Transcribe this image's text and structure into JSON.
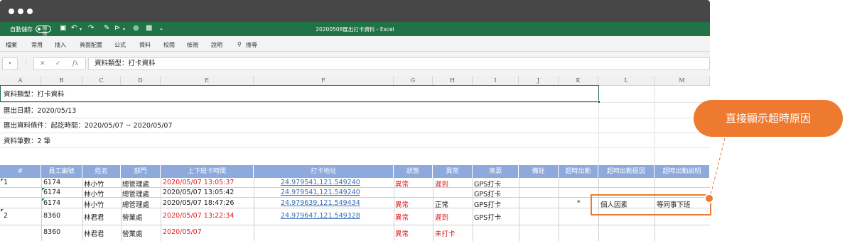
{
  "titlebar": {
    "autosave_label": "自動儲存",
    "autosave_state": "關閉",
    "title": "20200508匯出打卡資料 - Excel"
  },
  "menu": [
    "檔案",
    "常用",
    "插入",
    "頁面配置",
    "公式",
    "資料",
    "校閱",
    "檢視",
    "說明",
    "搜尋"
  ],
  "formula_bar": {
    "value": "資料類型：打卡資料"
  },
  "columns": [
    "A",
    "B",
    "C",
    "D",
    "E",
    "F",
    "G",
    "H",
    "I",
    "J",
    "K",
    "L",
    "M"
  ],
  "info_lines": [
    "資料類型：打卡資料",
    "匯出日期：2020/05/13",
    "匯出資料條件：起訖時間：2020/05/07 ~ 2020/05/07",
    "資料筆數：2 筆"
  ],
  "table": {
    "headers": [
      "#",
      "員工編號",
      "姓名",
      "部門",
      "上下班卡時間",
      "打卡地址",
      "狀態",
      "異常",
      "來源",
      "備註",
      "超時出勤",
      "超時出勤原因",
      "超時出勤說明"
    ],
    "rows": [
      [
        "1",
        "6174",
        "林小竹",
        "總管理處",
        "2020/05/07 13:05:37",
        "24.979541,121.549240",
        "異常",
        "遲到",
        "GPS打卡",
        "",
        "",
        "",
        ""
      ],
      [
        "",
        "6174",
        "林小竹",
        "總管理處",
        "2020/05/07 13:05:42",
        "24.979541,121.549240",
        "",
        "",
        "GPS打卡",
        "",
        "",
        "",
        ""
      ],
      [
        "",
        "6174",
        "林小竹",
        "總管理處",
        "2020/05/07 18:47:26",
        "24.979639,121.549434",
        "異常",
        "正常",
        "GPS打卡",
        "",
        "*",
        "個人因素",
        "等同事下班"
      ],
      [
        "2",
        "8360",
        "林君君",
        "營業處",
        "2020/05/07 13:22:34",
        "24.979647,121.549328",
        "異常",
        "遲到",
        "GPS打卡",
        "",
        "",
        "",
        ""
      ],
      [
        "",
        "8360",
        "林君君",
        "營業處",
        "2020/05/07",
        "",
        "異常",
        "未打卡",
        "",
        "",
        "",
        "",
        ""
      ]
    ]
  },
  "callout": {
    "text": "直接顯示超時原因"
  },
  "colors": {
    "excel_green": "#217346",
    "header_blue": "#8ea9db",
    "accent_orange": "#ee7a30",
    "red": "#e02020",
    "link_blue": "#3a6fb5"
  }
}
